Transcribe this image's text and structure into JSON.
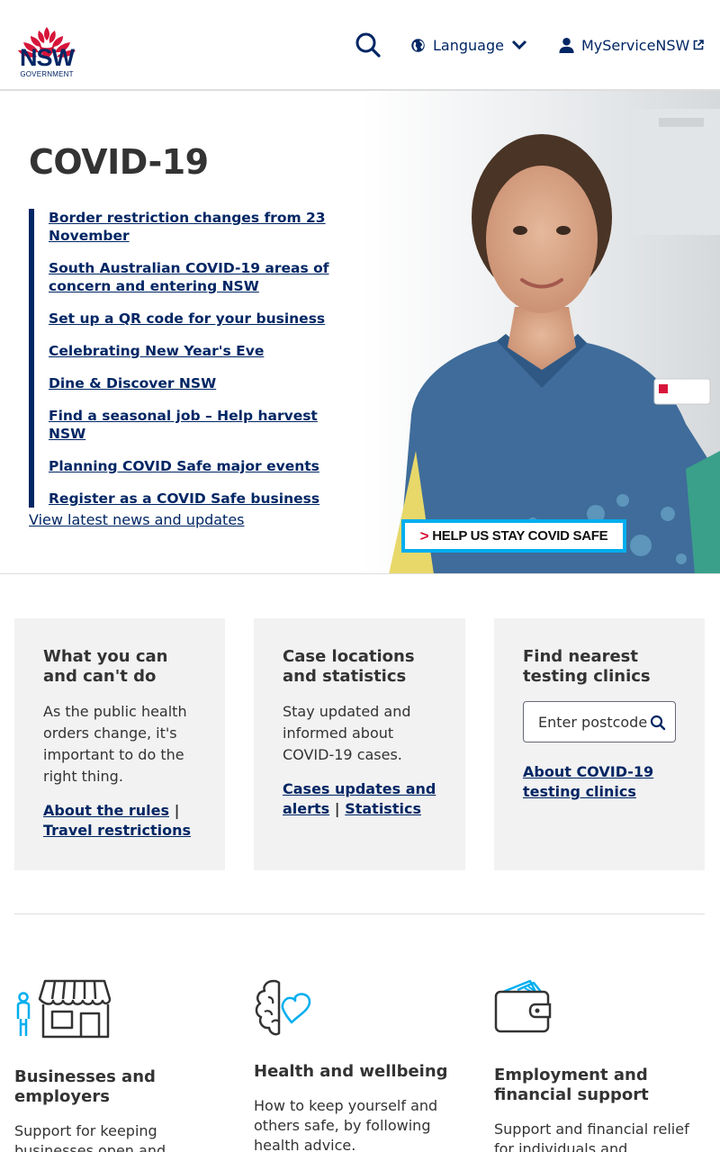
{
  "header": {
    "logo_text": "NSW",
    "logo_subtext": "GOVERNMENT",
    "language_label": "Language",
    "myservice_label": "MyServiceNSW"
  },
  "hero": {
    "title": "COVID-19",
    "links": [
      "Border restriction changes from 23 November",
      "South Australian COVID-19 areas of concern and entering NSW",
      "Set up a QR code for your business",
      "Celebrating New Year's Eve",
      "Dine & Discover NSW",
      "Find a seasonal job – Help harvest NSW",
      "Planning COVID Safe major events",
      "Register as a COVID Safe business"
    ],
    "news_link": "View latest news and updates",
    "badge_text": "HELP US STAY COVID SAFE",
    "badge_arrow": ">"
  },
  "cards": {
    "rules": {
      "title": "What you can and can't do",
      "body": "As the public health orders change, it's important to do the right thing.",
      "link1": "About the rules",
      "separator": "|",
      "link2": "Travel restrictions"
    },
    "cases": {
      "title": "Case locations and statistics",
      "body": "Stay updated and informed about COVID-19 cases.",
      "link1": "Cases updates and alerts",
      "separator": "|",
      "link2": "Statistics"
    },
    "testing": {
      "title": "Find nearest testing clinics",
      "placeholder": "Enter postcode",
      "link1": "About COVID-19 testing clinics"
    }
  },
  "categories": [
    {
      "title": "Businesses and employers",
      "body": "Support for keeping businesses open and",
      "icon": "storefront-icon"
    },
    {
      "title": "Health and wellbeing",
      "body": "How to keep yourself and others safe, by following health advice.",
      "icon": "brain-heart-icon"
    },
    {
      "title": "Employment and financial support",
      "body": "Support and financial relief for individuals and",
      "icon": "wallet-icon"
    }
  ],
  "colors": {
    "brand_navy": "#002664",
    "brand_red": "#d7153a",
    "accent_blue": "#00aeef",
    "card_bg": "#f2f2f2"
  }
}
